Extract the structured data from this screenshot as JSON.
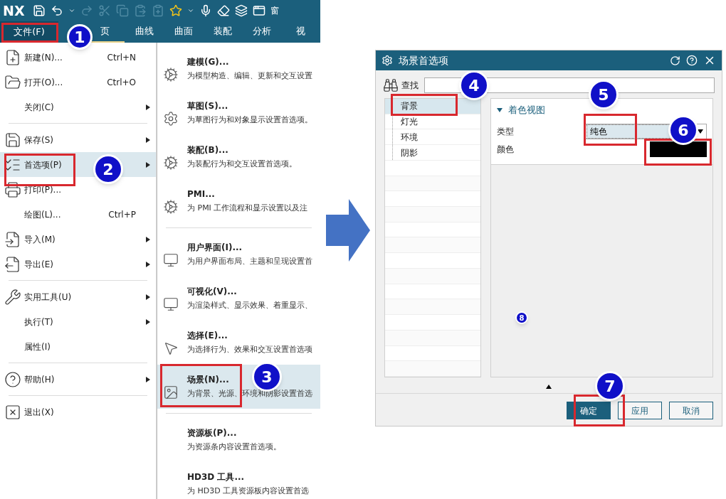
{
  "toolbar": {
    "logo": "NX",
    "buttons": [
      {
        "disabled": false
      },
      {
        "disabled": false
      },
      {
        "disabled": false
      },
      {
        "disabled": true
      },
      {
        "disabled": true
      },
      {
        "disabled": true
      },
      {
        "disabled": true
      },
      {
        "disabled": true
      },
      {
        "disabled": false
      },
      {
        "disabled": false
      },
      {
        "disabled": false
      },
      {
        "disabled": false
      },
      {
        "disabled": false
      },
      {
        "disabled": false
      }
    ],
    "window_menu": "窗"
  },
  "ribbon": {
    "file_button": "文件(F)",
    "tabs": [
      {
        "label": "页",
        "selected": true
      },
      {
        "label": "曲线",
        "selected": false
      },
      {
        "label": "曲面",
        "selected": false
      },
      {
        "label": "装配",
        "selected": false
      },
      {
        "label": "分析",
        "selected": false
      },
      {
        "label": "视",
        "selected": false
      }
    ]
  },
  "file_menu": [
    {
      "kind": "item",
      "label": "新建(N)...",
      "shortcut": "Ctrl+N",
      "submenu": false,
      "selected": false
    },
    {
      "kind": "item",
      "label": "打开(O)...",
      "shortcut": "Ctrl+O",
      "submenu": false,
      "selected": false
    },
    {
      "kind": "item",
      "label": "关闭(C)",
      "submenu": true,
      "selected": false
    },
    {
      "kind": "separator"
    },
    {
      "kind": "item",
      "label": "保存(S)",
      "submenu": true,
      "selected": false
    },
    {
      "kind": "item",
      "label": "首选项(P)",
      "submenu": true,
      "selected": true
    },
    {
      "kind": "item",
      "label": "打印(P)...",
      "submenu": false,
      "selected": false
    },
    {
      "kind": "item",
      "label": "绘图(L)...",
      "shortcut": "Ctrl+P",
      "submenu": false,
      "selected": false
    },
    {
      "kind": "item",
      "label": "导入(M)",
      "submenu": true,
      "selected": false
    },
    {
      "kind": "item",
      "label": "导出(E)",
      "submenu": true,
      "selected": false
    },
    {
      "kind": "separator"
    },
    {
      "kind": "item",
      "label": "实用工具(U)",
      "submenu": true,
      "selected": false
    },
    {
      "kind": "item",
      "label": "执行(T)",
      "submenu": true,
      "selected": false
    },
    {
      "kind": "item",
      "label": "属性(I)",
      "submenu": false,
      "selected": false
    },
    {
      "kind": "separator"
    },
    {
      "kind": "item",
      "label": "帮助(H)",
      "submenu": true,
      "selected": false
    },
    {
      "kind": "separator"
    },
    {
      "kind": "item",
      "label": "退出(X)",
      "submenu": false,
      "selected": false
    }
  ],
  "preferences_menu": [
    {
      "kind": "item",
      "title": "建模(G)...",
      "description": "为模型构造、编辑、更新和交互设置",
      "selected": false
    },
    {
      "kind": "item",
      "title": "草图(S)...",
      "description": "为草图行为和对象显示设置首选项。",
      "selected": false
    },
    {
      "kind": "item",
      "title": "装配(B)...",
      "description": "为装配行为和交互设置首选项。",
      "selected": false
    },
    {
      "kind": "item",
      "title": "PMI...",
      "description": "为 PMI 工作流程和显示设置以及注",
      "selected": false
    },
    {
      "kind": "separator"
    },
    {
      "kind": "item",
      "title": "用户界面(I)...",
      "description": "为用户界面布局、主题和呈现设置首",
      "selected": false
    },
    {
      "kind": "item",
      "title": "可视化(V)...",
      "description": "为渲染样式、显示效果、着重显示、",
      "selected": false
    },
    {
      "kind": "item",
      "title": "选择(E)...",
      "description": "为选择行为、效果和交互设置首选项",
      "selected": false
    },
    {
      "kind": "item",
      "title": "场景(N)...",
      "description": "为背景、光源、环境和阴影设置首选",
      "selected": true
    },
    {
      "kind": "separator"
    },
    {
      "kind": "item",
      "title": "资源板(P)...",
      "description": "为资源条内容设置首选项。",
      "selected": false
    },
    {
      "kind": "item",
      "title": "HD3D 工具...",
      "description": "为 HD3D 工具资源板内容设置首选",
      "selected": false
    }
  ],
  "dialog": {
    "title": "场景首选项",
    "search_label": "查找",
    "tree": [
      {
        "label": "背景",
        "selected": true
      },
      {
        "label": "灯光",
        "selected": false
      },
      {
        "label": "环境",
        "selected": false
      },
      {
        "label": "阴影",
        "selected": false
      }
    ],
    "section": {
      "title": "着色视图",
      "expanded": true,
      "type_label": "类型",
      "type_value": "纯色",
      "color_label": "颜色",
      "color": "#000000"
    },
    "buttons": [
      {
        "label": "确定",
        "primary": true
      },
      {
        "label": "应用",
        "primary": false
      },
      {
        "label": "取消",
        "primary": false
      }
    ]
  },
  "annotations": [
    "1",
    "2",
    "3",
    "4",
    "5",
    "6",
    "7",
    "8"
  ]
}
